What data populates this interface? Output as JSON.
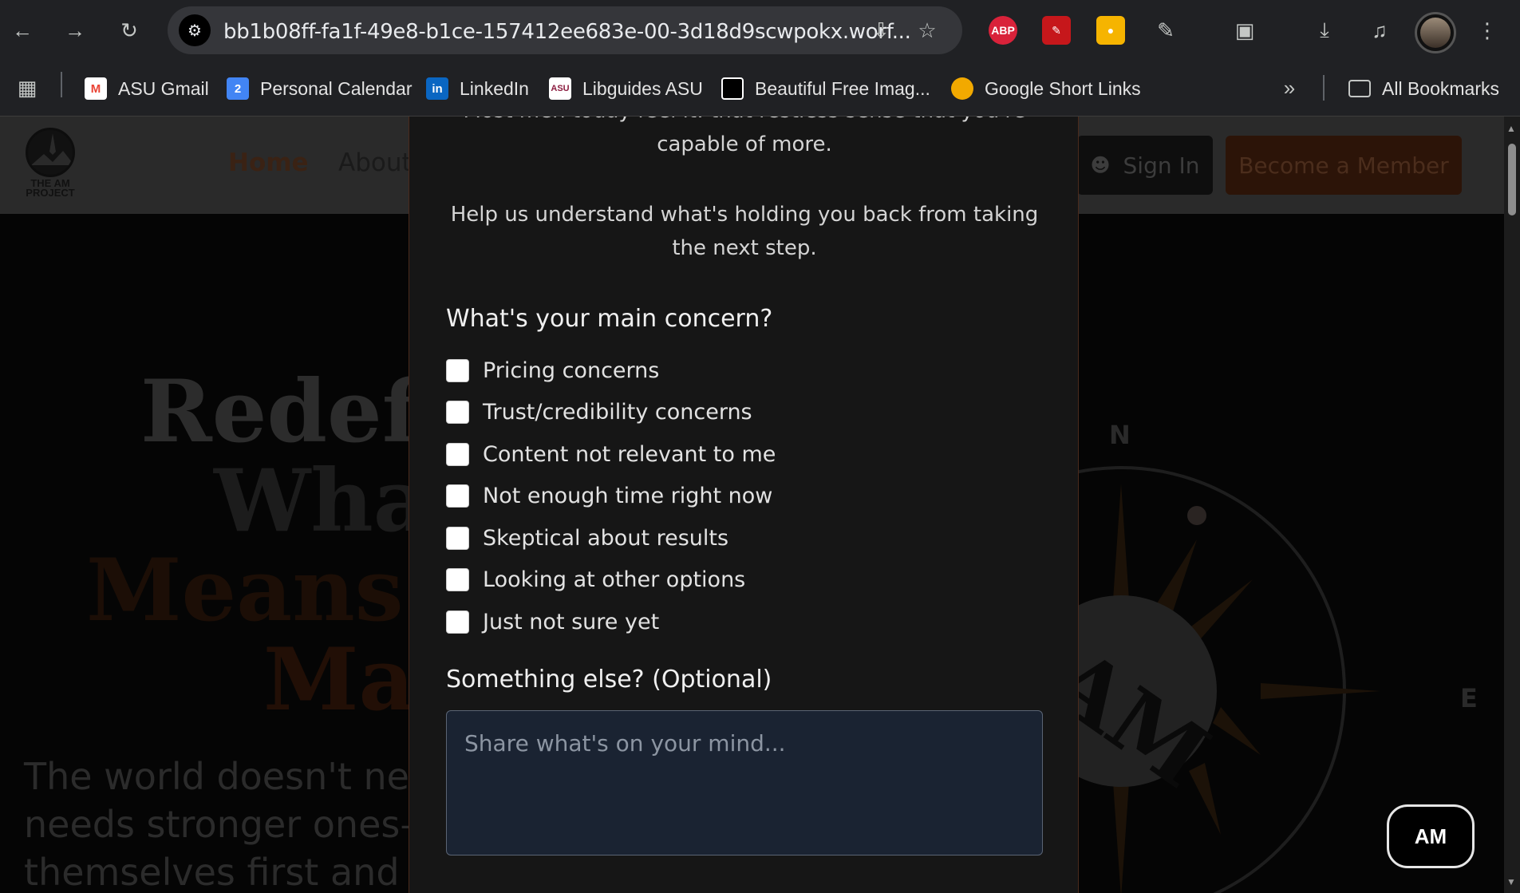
{
  "browser": {
    "url": "bb1b08ff-fa1f-49e8-b1ce-157412ee683e-00-3d18d9scwpokx.worf...",
    "extensions": [
      "ABP"
    ],
    "bookmarks": [
      {
        "label": "ASU Gmail"
      },
      {
        "label": "Personal Calendar"
      },
      {
        "label": "LinkedIn"
      },
      {
        "label": "Libguides ASU"
      },
      {
        "label": "Beautiful Free Imag..."
      },
      {
        "label": "Google Short Links"
      }
    ],
    "all_bookmarks": "All Bookmarks",
    "calendar_day": "2",
    "asu_icon_text": "ASU",
    "linkedin_icon_text": "in"
  },
  "site": {
    "logo_text": "THE AM PROJECT",
    "nav": {
      "home": "Home",
      "about": "About"
    },
    "sign_in": "Sign In",
    "become_member": "Become a Member",
    "hero": [
      "Redefi",
      "What",
      "Means t",
      "Man"
    ],
    "subtitle": [
      "The world doesn't nee",
      "needs stronger ones—",
      "themselves first and l"
    ],
    "compass": {
      "north": "N",
      "east": "E",
      "center": "AM"
    },
    "chat_button": "AM"
  },
  "modal": {
    "intro_partial": "Most men today feel it: that restless sense that you're",
    "intro_end": "capable of more.",
    "help_line1": "Help us understand what's holding you back from taking",
    "help_line2": "the next step.",
    "concern_heading": "What's your main concern?",
    "options": [
      "Pricing concerns",
      "Trust/credibility concerns",
      "Content not relevant to me",
      "Not enough time right now",
      "Skeptical about results",
      "Looking at other options",
      "Just not sure yet"
    ],
    "else_heading": "Something else? (Optional)",
    "textarea_placeholder": "Share what's on your mind..."
  }
}
